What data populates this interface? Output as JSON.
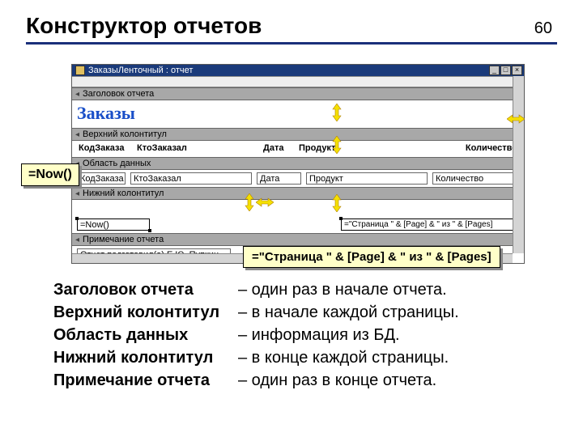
{
  "slide": {
    "title": "Конструктор отчетов",
    "page_number": "60"
  },
  "window": {
    "title": "ЗаказыЛенточный : отчет"
  },
  "bands": {
    "report_header": "Заголовок отчета",
    "page_header": "Верхний колонтитул",
    "detail": "Область данных",
    "page_footer": "Нижний колонтитул",
    "report_footer": "Примечание отчета"
  },
  "report_title": "Заказы",
  "columns": {
    "code": "КодЗаказа",
    "customer": "КтоЗаказал",
    "date": "Дата",
    "product": "Продукт",
    "qty": "Количество"
  },
  "detail_fields": {
    "code": "КодЗаказа",
    "customer": "КтоЗаказал",
    "date": "Дата",
    "product": "Продукт",
    "qty": "Количество"
  },
  "footer_fields": {
    "now": "=Now()",
    "pages": "=\"Страница \" & [Page] & \" из \" & [Pages]"
  },
  "report_note": "Отчет подготовил(а) Е.Ю. Пупкин",
  "callouts": {
    "now_expr": "=Now()",
    "pages_expr": "=\"Страница \" & [Page] & \" из \" & [Pages]"
  },
  "definitions": [
    {
      "term": "Заголовок отчета",
      "desc": "– один раз в начале отчета."
    },
    {
      "term": "Верхний колонтитул",
      "desc": "– в начале каждой страницы."
    },
    {
      "term": "Область данных",
      "desc": "– информация из БД."
    },
    {
      "term": "Нижний колонтитул",
      "desc": "– в конце каждой страницы."
    },
    {
      "term": "Примечание отчета",
      "desc": "– один раз в конце отчета."
    }
  ]
}
